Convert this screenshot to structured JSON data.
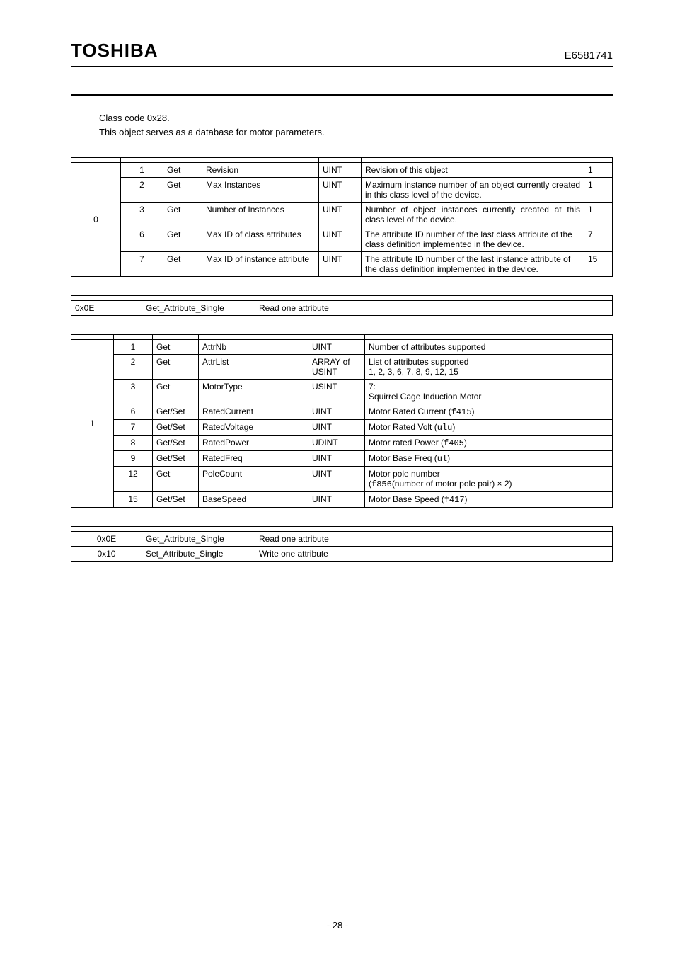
{
  "header": {
    "brand": "TOSHIBA",
    "docnum": "E6581741"
  },
  "intro": {
    "line1": "Class code 0x28.",
    "line2": "This object serves as a database for motor parameters."
  },
  "classAttr": {
    "instance": "0",
    "rows": [
      {
        "attr": "1",
        "access": "Get",
        "name": "Revision",
        "type": "UINT",
        "desc": "Revision of this object",
        "val": "1"
      },
      {
        "attr": "2",
        "access": "Get",
        "name": "Max Instances",
        "type": "UINT",
        "desc": "Maximum instance number of an object currently created in this class level of the device.",
        "val": "1"
      },
      {
        "attr": "3",
        "access": "Get",
        "name": "Number of Instances",
        "type": "UINT",
        "desc": "Number of object instances currently created at this class level of the device.",
        "val": "1"
      },
      {
        "attr": "6",
        "access": "Get",
        "name": "Max ID of class attributes",
        "type": "UINT",
        "desc": "The attribute ID number of the last class attribute of the class definition implemented in the device.",
        "val": "7"
      },
      {
        "attr": "7",
        "access": "Get",
        "name": "Max ID of instance attribute",
        "type": "UINT",
        "desc": "The attribute ID number of the last instance attribute of the class definition implemented in the device.",
        "val": "15"
      }
    ]
  },
  "classSvc": {
    "code": "0x0E",
    "name": "Get_Attribute_Single",
    "desc": "Read one attribute"
  },
  "instAttr": {
    "instance": "1",
    "rows": [
      {
        "attr": "1",
        "access": "Get",
        "name": "AttrNb",
        "type": "UINT",
        "desc": "Number of attributes supported"
      },
      {
        "attr": "2",
        "access": "Get",
        "name": "AttrList",
        "type": "ARRAY of USINT",
        "desc": "List of attributes supported\n1, 2, 3, 6, 7, 8, 9, 12, 15"
      },
      {
        "attr": "3",
        "access": "Get",
        "name": "MotorType",
        "type": "USINT",
        "desc": "7:\nSquirrel Cage Induction Motor"
      },
      {
        "attr": "6",
        "access": "Get/Set",
        "name": "RatedCurrent",
        "type": "UINT",
        "desc": "Motor Rated Current (",
        "param": "f415",
        "desc2": ")"
      },
      {
        "attr": "7",
        "access": "Get/Set",
        "name": "RatedVoltage",
        "type": "UINT",
        "desc": "Motor Rated Volt (",
        "param": "ulu",
        "desc2": ")"
      },
      {
        "attr": "8",
        "access": "Get/Set",
        "name": "RatedPower",
        "type": "UDINT",
        "desc": "Motor rated Power (",
        "param": "f405",
        "desc2": ")"
      },
      {
        "attr": "9",
        "access": "Get/Set",
        "name": "RatedFreq",
        "type": "UINT",
        "desc": "Motor Base Freq (",
        "param": "ul",
        "desc2": ")"
      },
      {
        "attr": "12",
        "access": "Get",
        "name": "PoleCount",
        "type": "UINT",
        "desc": "Motor pole number\n(",
        "param": "f856",
        "desc2": "(number of motor pole pair) × 2)"
      },
      {
        "attr": "15",
        "access": "Get/Set",
        "name": "BaseSpeed",
        "type": "UINT",
        "desc": "Motor Base Speed (",
        "param": "f417",
        "desc2": ")"
      }
    ]
  },
  "instSvc": {
    "rows": [
      {
        "code": "0x0E",
        "name": "Get_Attribute_Single",
        "desc": "Read one attribute"
      },
      {
        "code": "0x10",
        "name": "Set_Attribute_Single",
        "desc": "Write one attribute"
      }
    ]
  },
  "footer": "- 28 -"
}
